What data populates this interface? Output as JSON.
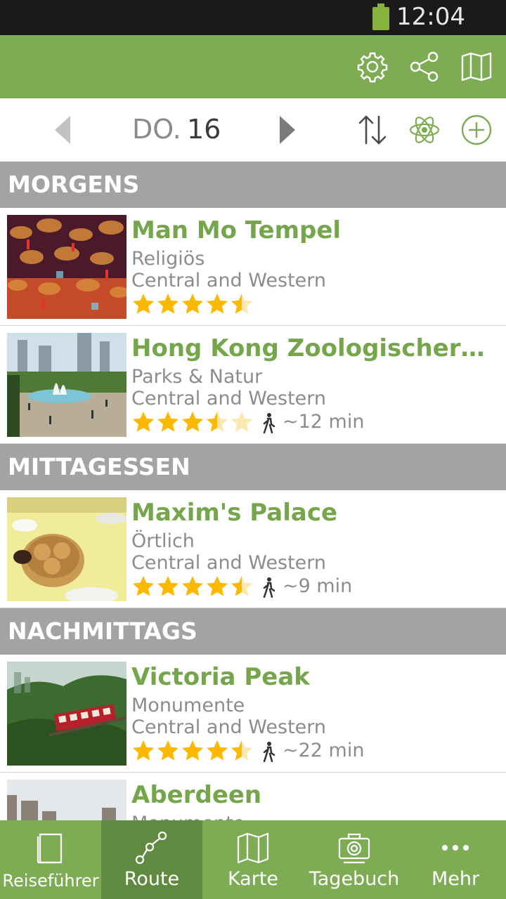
{
  "status_bar": {
    "time": "12:04 PM"
  },
  "day_nav": {
    "weekday": "DO.",
    "day": "16"
  },
  "sections": [
    {
      "label": "MORGENS",
      "items": [
        {
          "title": "Man Mo Tempel",
          "category": "Religiös",
          "area": "Central and Western",
          "rating": 4.5,
          "walk_time": ""
        }
      ]
    },
    {
      "label": "",
      "items": [
        {
          "title": "Hong Kong Zoologischer und...",
          "category": "Parks & Natur",
          "area": "Central and Western",
          "rating": 3.5,
          "walk_time": "~12 min"
        }
      ]
    },
    {
      "label": "MITTAGESSEN",
      "items": [
        {
          "title": "Maxim's Palace",
          "category": "Örtlich",
          "area": "Central and Western",
          "rating": 4.5,
          "walk_time": "~9 min"
        }
      ]
    },
    {
      "label": "NACHMITTAGS",
      "items": [
        {
          "title": "Victoria Peak",
          "category": "Monumente",
          "area": "Central and Western",
          "rating": 4.5,
          "walk_time": "~22 min"
        },
        {
          "title": "Aberdeen",
          "category": "Monumente",
          "area": "",
          "rating": 0,
          "walk_time": ""
        }
      ]
    }
  ],
  "tabs": [
    {
      "label": "Reiseführer",
      "icon": "book-icon"
    },
    {
      "label": "Route",
      "icon": "route-icon",
      "active": true
    },
    {
      "label": "Karte",
      "icon": "map-icon"
    },
    {
      "label": "Tagebuch",
      "icon": "camera-icon"
    },
    {
      "label": "Mehr",
      "icon": "more-icon"
    }
  ],
  "colors": {
    "brand": "#7dac55",
    "brand_dark": "#5f8a3f",
    "title_green": "#76a64c",
    "section_gray": "#a3a3a3",
    "star": "#fcb900",
    "star_empty": "#fde7b0"
  }
}
